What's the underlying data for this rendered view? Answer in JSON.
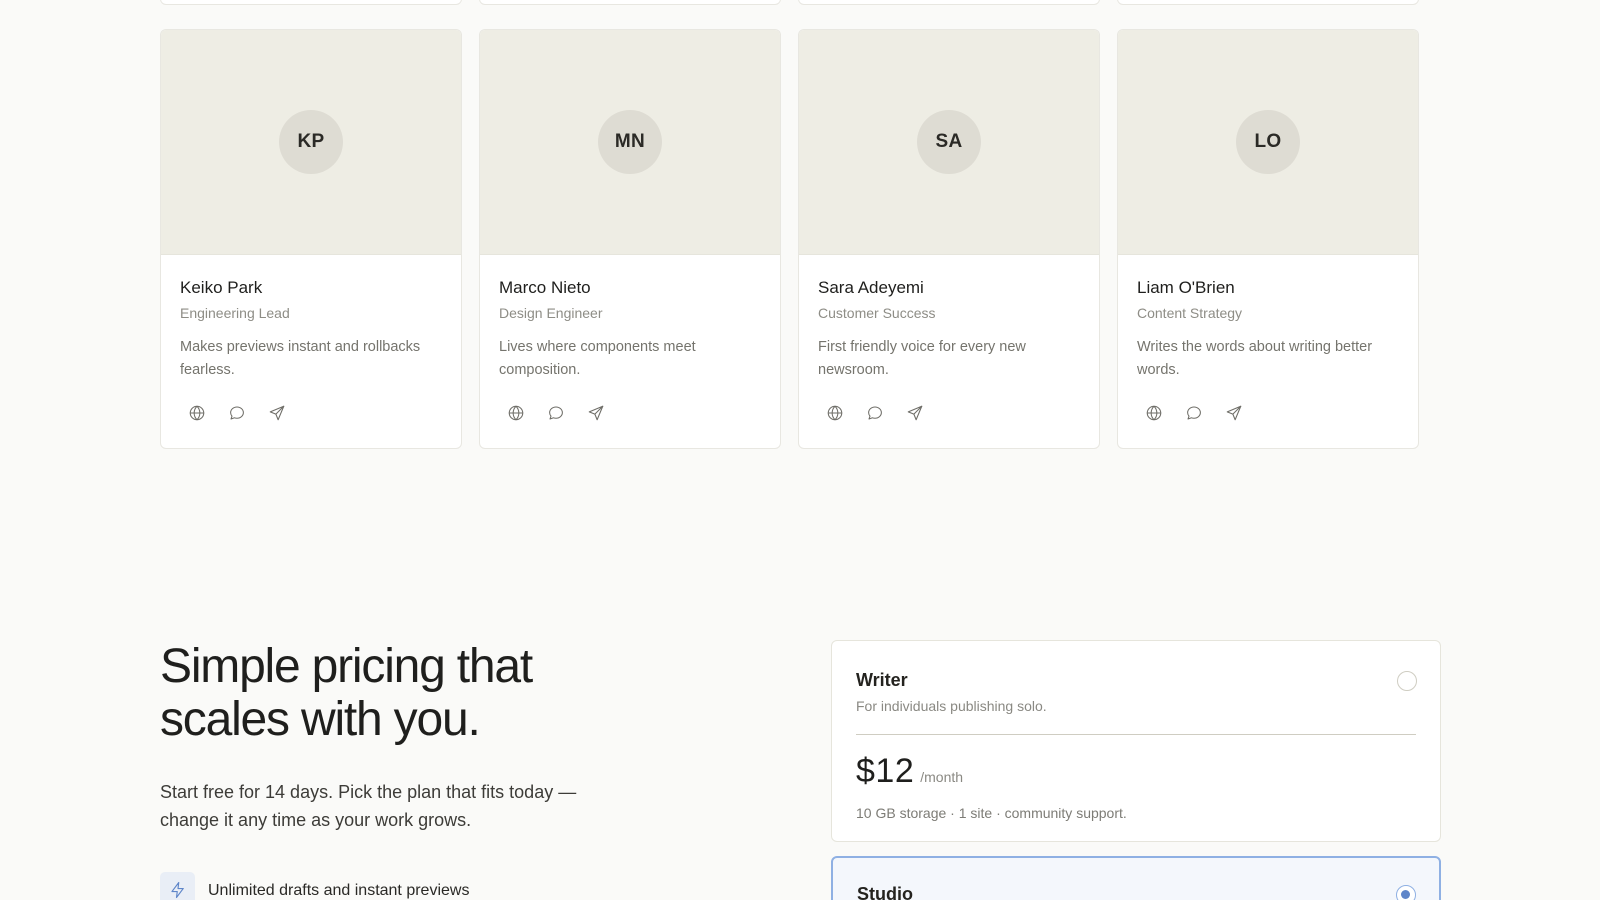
{
  "team": {
    "members": [
      {
        "initials": "KP",
        "name": "Keiko Park",
        "role": "Engineering Lead",
        "bio": "Makes previews instant and rollbacks fearless."
      },
      {
        "initials": "MN",
        "name": "Marco Nieto",
        "role": "Design Engineer",
        "bio": "Lives where components meet composition."
      },
      {
        "initials": "SA",
        "name": "Sara Adeyemi",
        "role": "Customer Success",
        "bio": "First friendly voice for every new newsroom."
      },
      {
        "initials": "LO",
        "name": "Liam O'Brien",
        "role": "Content Strategy",
        "bio": "Writes the words about writing better words."
      }
    ],
    "social_icons": [
      "globe-icon",
      "chat-bubble-icon",
      "send-icon"
    ]
  },
  "pricing": {
    "heading": "Simple pricing that scales with you.",
    "subheading": "Start free for 14 days. Pick the plan that fits today — change it any time as your work grows.",
    "features": [
      {
        "icon": "lightning-icon",
        "text": "Unlimited drafts and instant previews"
      }
    ],
    "plans": [
      {
        "name": "Writer",
        "description": "For individuals publishing solo.",
        "price": "$12",
        "period": "/month",
        "details": "10 GB storage · 1 site · community support.",
        "selected": false
      },
      {
        "name": "Studio",
        "selected": true
      }
    ]
  },
  "colors": {
    "accent": "#5f86c9",
    "card_photo_bg": "#eeede4",
    "page_bg": "#fafaf8"
  }
}
